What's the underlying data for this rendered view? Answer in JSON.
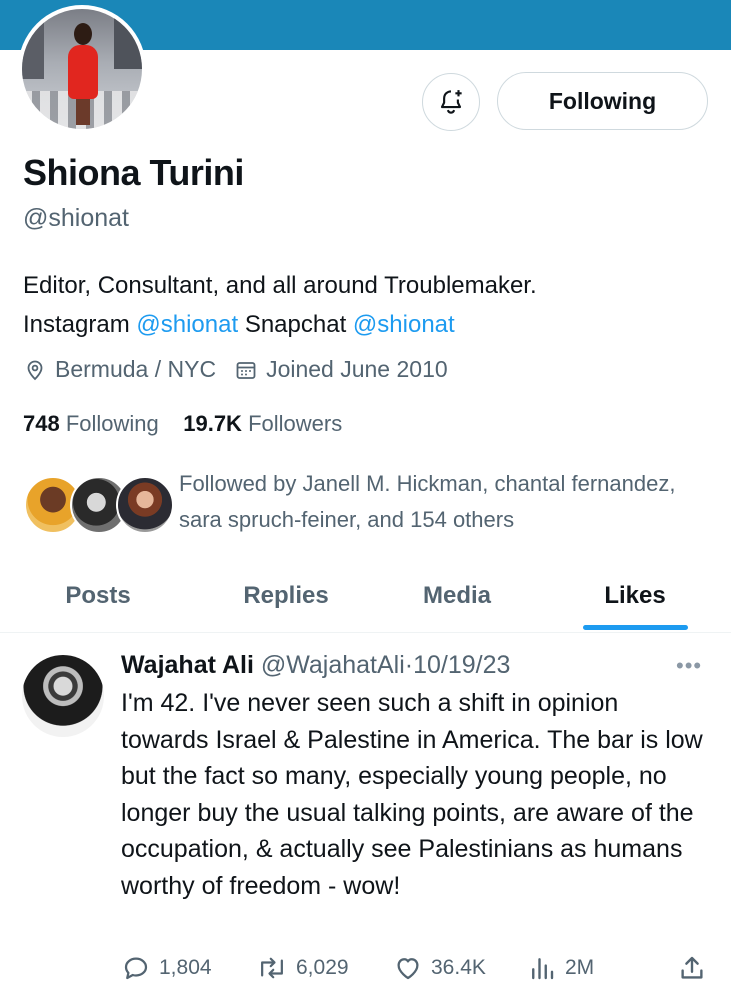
{
  "colors": {
    "banner": "#1a87b8",
    "link": "#1d9bf0",
    "secondary_text": "#536471",
    "primary_text": "#0f1419"
  },
  "profile": {
    "notify_icon": "bell-plus-icon",
    "follow_button_label": "Following",
    "name": "Shiona Turini",
    "handle": "@shionat",
    "bio": {
      "line1": "Editor, Consultant, and all around Troublemaker.",
      "instagram_label": "Instagram",
      "instagram_link": "@shionat",
      "snapchat_label": "Snapchat",
      "snapchat_link": "@shionat"
    },
    "location_icon": "location-pin-icon",
    "location": "Bermuda / NYC",
    "joined_icon": "calendar-icon",
    "joined": "Joined June 2010",
    "following_count": "748",
    "following_label": "Following",
    "followers_count": "19.7K",
    "followers_label": "Followers",
    "followed_by": "Followed by Janell M. Hickman, chantal fernandez, sara spruch-feiner, and 154 others"
  },
  "tabs": [
    {
      "label": "Posts",
      "active": false
    },
    {
      "label": "Replies",
      "active": false
    },
    {
      "label": "Media",
      "active": false
    },
    {
      "label": "Likes",
      "active": true
    }
  ],
  "tweet": {
    "author_name": "Wajahat Ali",
    "author_handle": "@WajahatAli",
    "separator": "·",
    "date": "10/19/23",
    "more_icon": "more-horizontal-icon",
    "more_label": "•••",
    "text": "I'm 42. I've never seen such a shift in opinion towards Israel & Palestine in America. The bar is low but the fact so many, especially young people, no longer buy the usual talking points, are aware of the occupation, & actually see Palestinians as humans worthy of freedom - wow!",
    "replies": "1,804",
    "reposts": "6,029",
    "likes": "36.4K",
    "views": "2M",
    "icons": [
      "reply-icon",
      "repost-icon",
      "like-icon",
      "views-icon",
      "share-icon"
    ]
  }
}
